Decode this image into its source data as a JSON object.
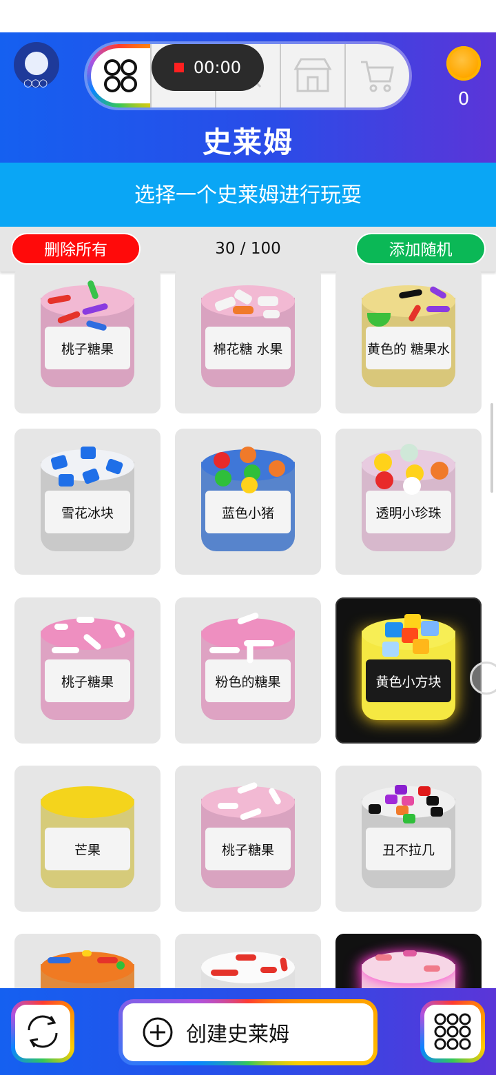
{
  "header": {
    "title": "史莱姆",
    "record_timer": "00:00",
    "coins": "0",
    "nav_items": [
      "grid-icon",
      "jar-icon",
      "search-icon",
      "store-icon",
      "cart-icon"
    ]
  },
  "subtitle": "选择一个史莱姆进行玩耍",
  "actions": {
    "delete_all": "删除所有",
    "count": "30 / 100",
    "add_random": "添加随机"
  },
  "slimes": [
    {
      "label": "桃子糖果"
    },
    {
      "label": "棉花糖 水果"
    },
    {
      "label": "黄色的 糖果水"
    },
    {
      "label": "雪花冰块"
    },
    {
      "label": "蓝色小猪"
    },
    {
      "label": "透明小珍珠"
    },
    {
      "label": "桃子糖果"
    },
    {
      "label": "粉色的糖果"
    },
    {
      "label": "黄色小方块"
    },
    {
      "label": "芒果"
    },
    {
      "label": "桃子糖果"
    },
    {
      "label": "丑不拉几"
    },
    {
      "label": ""
    },
    {
      "label": ""
    },
    {
      "label": ""
    }
  ],
  "bottom": {
    "create_label": "创建史莱姆"
  },
  "colors": {
    "header_start": "#1560f0",
    "header_end": "#5b35d8",
    "subtitle_bg": "#0aa6f5",
    "delete_red": "#ff0a0a",
    "add_green": "#0bb856"
  }
}
